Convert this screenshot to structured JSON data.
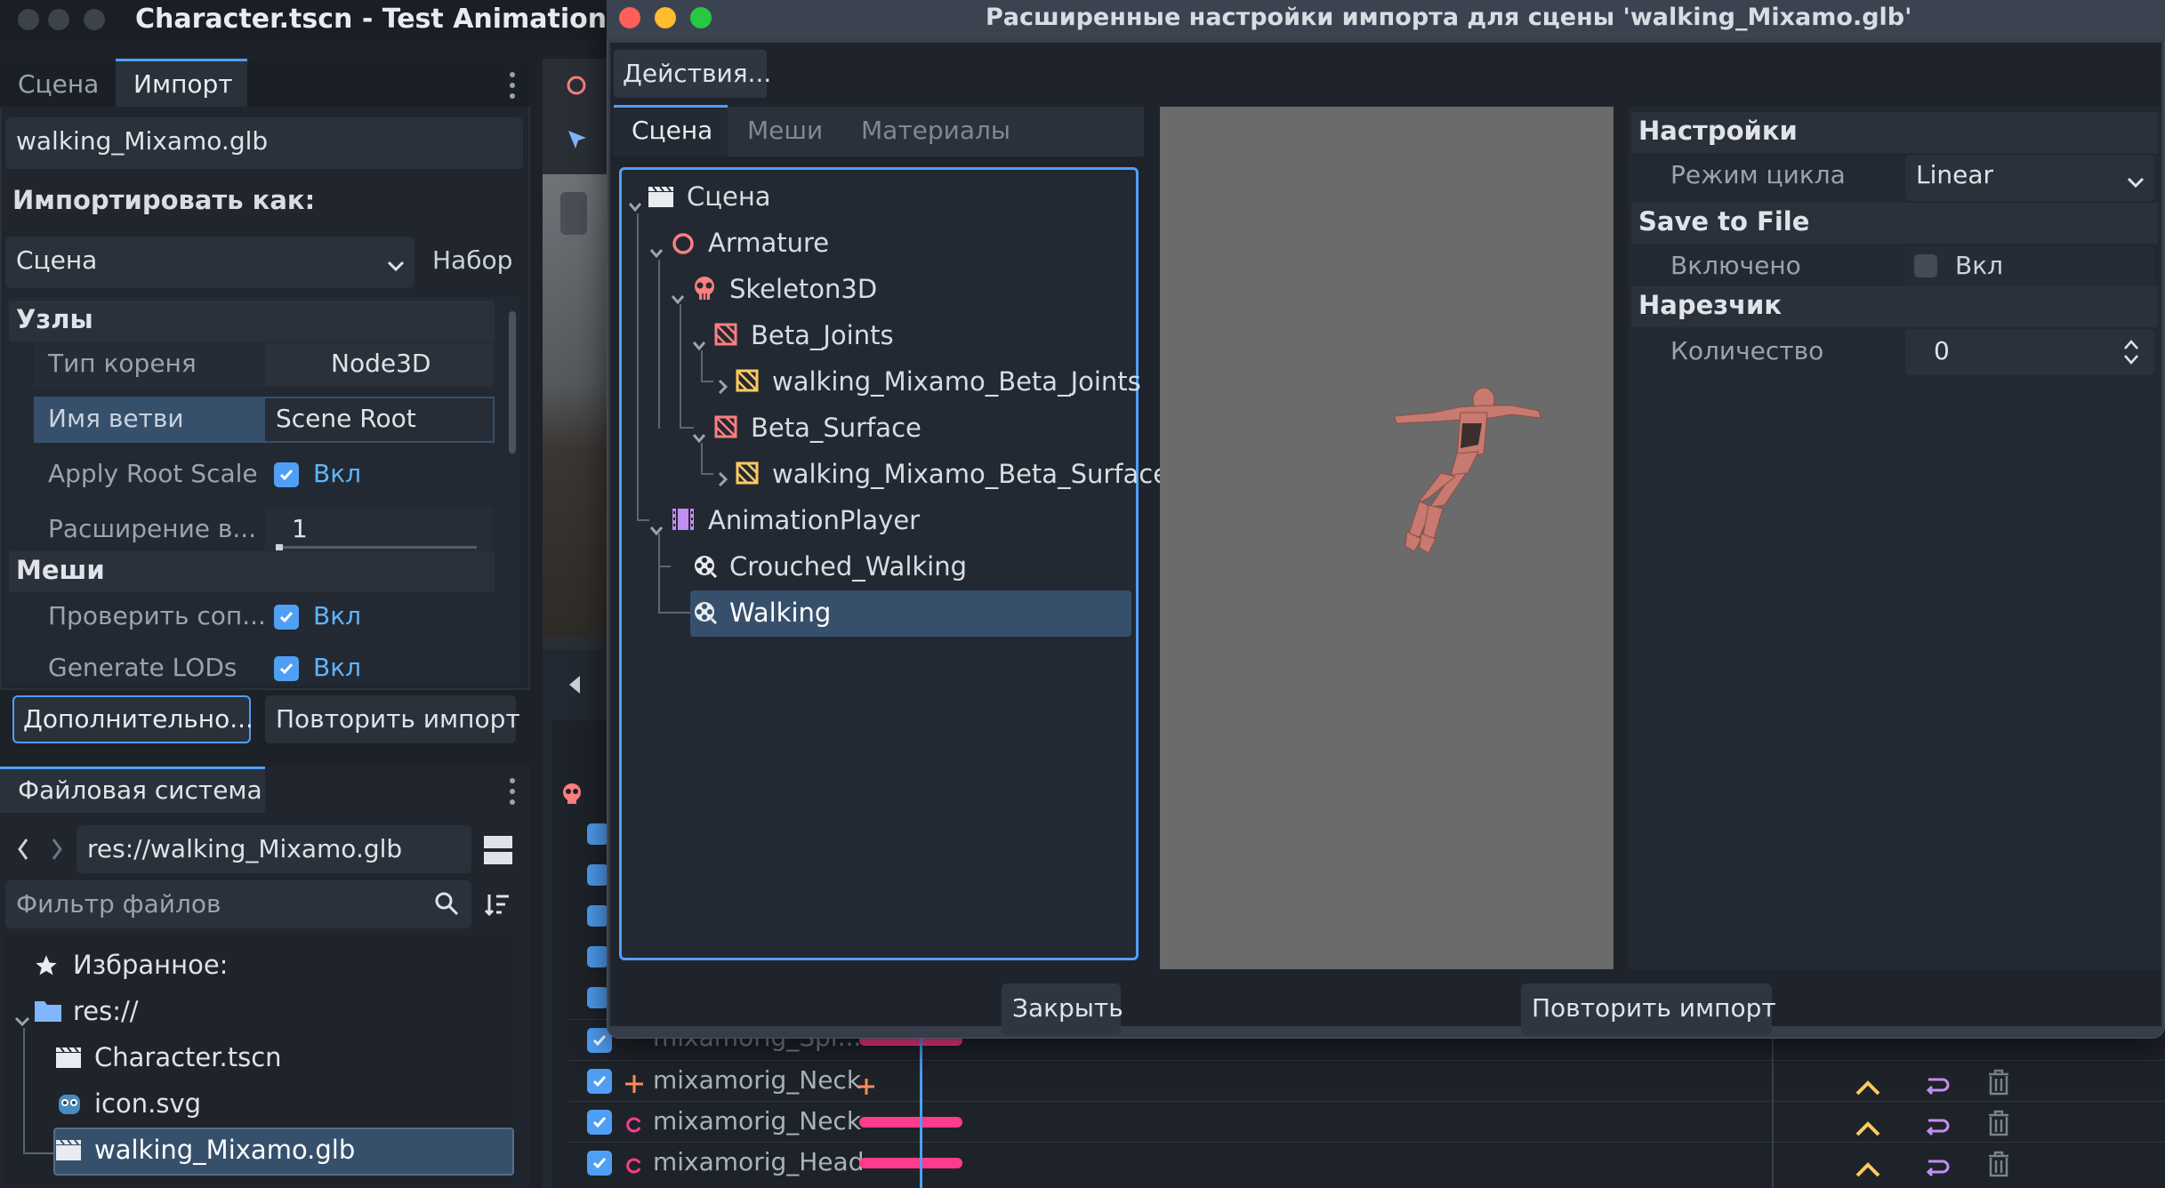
{
  "editor": {
    "title": "Character.tscn - Test Animation"
  },
  "dock_top": {
    "tabs": [
      "Сцена",
      "Импорт"
    ],
    "active_tab": "Импорт",
    "file_name": "walking_Mixamo.glb",
    "import_as_label": "Импортировать как:",
    "import_as_value": "Сцена",
    "preset_button": "Набор",
    "sections": {
      "nodes_title": "Узлы",
      "meshes_title": "Меши"
    },
    "props": {
      "root_type_label": "Тип кореня",
      "root_type_value": "Node3D",
      "root_name_label": "Имя ветви",
      "root_name_value": "Scene Root",
      "apply_root_scale_label": "Apply Root Scale",
      "apply_root_scale_value": "Вкл",
      "extension_label": "Расширение в...",
      "extension_value": "1",
      "check_label": "Проверить соп...",
      "check_value": "Вкл",
      "lods_label": "Generate LODs",
      "lods_value": "Вкл"
    },
    "advanced_button": "Дополнительно...",
    "reimport_button": "Повторить импорт"
  },
  "filesystem": {
    "tab": "Файловая система",
    "path": "res://walking_Mixamo.glb",
    "filter_placeholder": "Фильтр файлов",
    "favorites": "Избранное:",
    "root": "res://",
    "files": [
      "Character.tscn",
      "icon.svg",
      "walking_Mixamo.glb"
    ],
    "selected_file": "walking_Mixamo.glb"
  },
  "tracks": {
    "rows": [
      "mixamorig_Spi...",
      "mixamorig_Neck",
      "mixamorig_Neck",
      "mixamorig_Head"
    ]
  },
  "dialog": {
    "title": "Расширенные настройки импорта для сцены 'walking_Mixamo.glb'",
    "actions_button": "Действия...",
    "tabs": [
      "Сцена",
      "Меши",
      "Материалы"
    ],
    "active_tab": "Сцена",
    "tree": {
      "scene": "Сцена",
      "armature": "Armature",
      "skeleton": "Skeleton3D",
      "beta_joints": "Beta_Joints",
      "beta_joints_mesh": "walking_Mixamo_Beta_Joints",
      "beta_surface": "Beta_Surface",
      "beta_surface_mesh": "walking_Mixamo_Beta_Surface",
      "anim_player": "AnimationPlayer",
      "anim_crouched": "Crouched_Walking",
      "anim_walking": "Walking"
    },
    "selected_node": "Walking",
    "settings": {
      "section_settings": "Настройки",
      "loop_mode_label": "Режим цикла",
      "loop_mode_value": "Linear",
      "section_save": "Save to File",
      "enabled_label": "Включено",
      "enabled_value": "Вкл",
      "section_slicer": "Нарезчик",
      "count_label": "Количество",
      "count_value": "0"
    },
    "close_button": "Закрыть",
    "reimport_button": "Повторить импорт"
  },
  "colors": {
    "accent": "#4f9ff5",
    "node3d_red": "#fc7f7f",
    "mesh_yellow": "#ffca5f",
    "anim_purple": "#c38ef1",
    "keyframe_pink": "#ff3b8d"
  }
}
